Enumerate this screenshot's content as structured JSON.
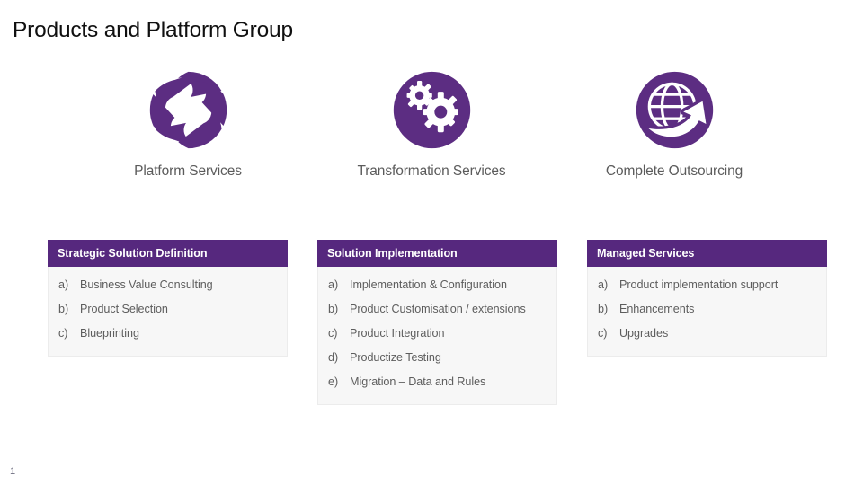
{
  "slide": {
    "title": "Products and Platform Group",
    "page_number": "1",
    "colors": {
      "header_purple": "#56287E",
      "icon_purple": "#5C2D82",
      "card_body_bg": "#F7F7F7",
      "body_text": "#5D5D5D",
      "caption_text": "#5B5B5B",
      "title_text": "#101010",
      "icon_glyph": "#FFFFFF"
    }
  },
  "pillars": [
    {
      "icon": "aperture-icon",
      "caption": "Platform Services"
    },
    {
      "icon": "gears-icon",
      "caption": "Transformation Services"
    },
    {
      "icon": "globe-arrow-icon",
      "caption": "Complete Outsourcing"
    }
  ],
  "cards": [
    {
      "header": "Strategic Solution Definition",
      "items": [
        {
          "marker": "a)",
          "text": "Business Value Consulting"
        },
        {
          "marker": "b)",
          "text": "Product Selection"
        },
        {
          "marker": "c)",
          "text": "Blueprinting"
        }
      ]
    },
    {
      "header": "Solution Implementation",
      "items": [
        {
          "marker": "a)",
          "text": "Implementation & Configuration"
        },
        {
          "marker": "b)",
          "text": "Product Customisation / extensions"
        },
        {
          "marker": "c)",
          "text": "Product Integration"
        },
        {
          "marker": "d)",
          "text": "Productize Testing"
        },
        {
          "marker": "e)",
          "text": "Migration – Data and Rules"
        }
      ]
    },
    {
      "header": "Managed Services",
      "items": [
        {
          "marker": "a)",
          "text": "Product implementation support"
        },
        {
          "marker": "b)",
          "text": "Enhancements"
        },
        {
          "marker": "c)",
          "text": "Upgrades"
        }
      ]
    }
  ]
}
